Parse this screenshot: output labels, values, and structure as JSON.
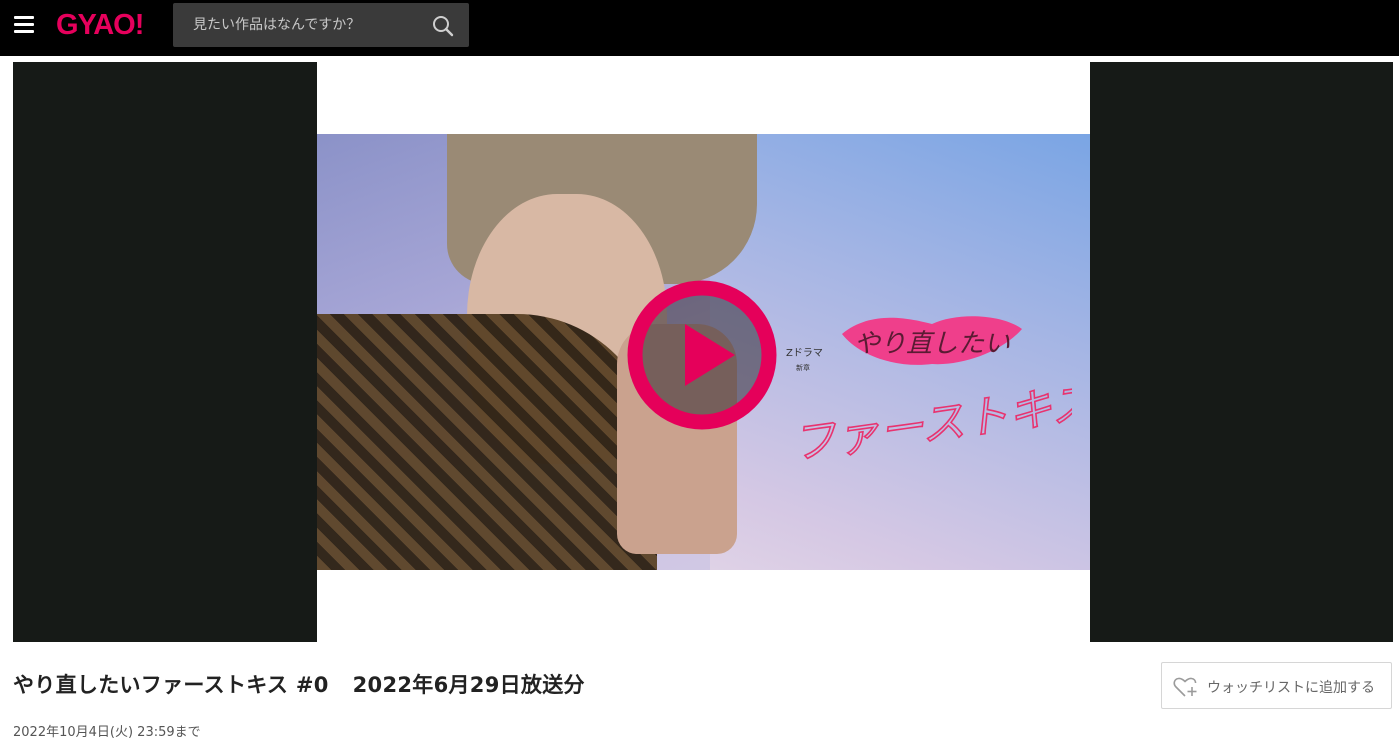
{
  "header": {
    "menu_icon": "hamburger-menu-icon",
    "logo": "GYAO!",
    "logo_color": "#e6005c",
    "search": {
      "placeholder": "見たい作品はなんですか？",
      "value": "",
      "icon": "search-icon"
    }
  },
  "player": {
    "play_icon": "play-icon",
    "accent_color": "#e5005a",
    "key_art": {
      "subtitle_label": "Zドラマ",
      "subtitle_sub": "新章",
      "title_line1": "やり直したい",
      "title_line2": "ファーストキス"
    }
  },
  "episode": {
    "title": "やり直したいファーストキス #0",
    "broadcast": "2022年6月29日放送分",
    "availability": "2022年10月4日(火) 23:59まで"
  },
  "watchlist": {
    "label": "ウォッチリストに追加する",
    "icon": "heart-plus-icon"
  }
}
